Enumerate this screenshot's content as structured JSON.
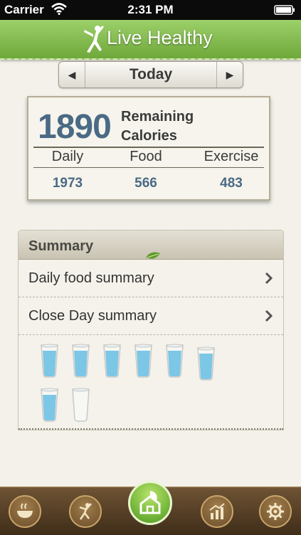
{
  "status": {
    "carrier": "Carrier",
    "time": "2:31 PM"
  },
  "header": {
    "brand": "Live Healthy"
  },
  "date_nav": {
    "label": "Today"
  },
  "calories": {
    "remaining_value": "1890",
    "remaining_label_line1": "Remaining",
    "remaining_label_line2": "Calories",
    "columns": [
      {
        "label": "Daily",
        "value": "1973"
      },
      {
        "label": "Food",
        "value": "566"
      },
      {
        "label": "Exercise",
        "value": "483"
      }
    ]
  },
  "summary": {
    "title": "Summary",
    "items": [
      {
        "label": "Daily food summary"
      },
      {
        "label": "Close Day summary"
      }
    ],
    "water": {
      "filled": 7,
      "total": 8
    }
  },
  "colors": {
    "header_green": "#7fb84a",
    "value_blue": "#4a6a85",
    "tabbar_brown": "#5a4227"
  },
  "tabs": [
    {
      "icon": "bowl-icon"
    },
    {
      "icon": "exercise-icon"
    },
    {
      "icon": "home-icon",
      "active": true
    },
    {
      "icon": "chart-icon"
    },
    {
      "icon": "gear-icon"
    }
  ]
}
